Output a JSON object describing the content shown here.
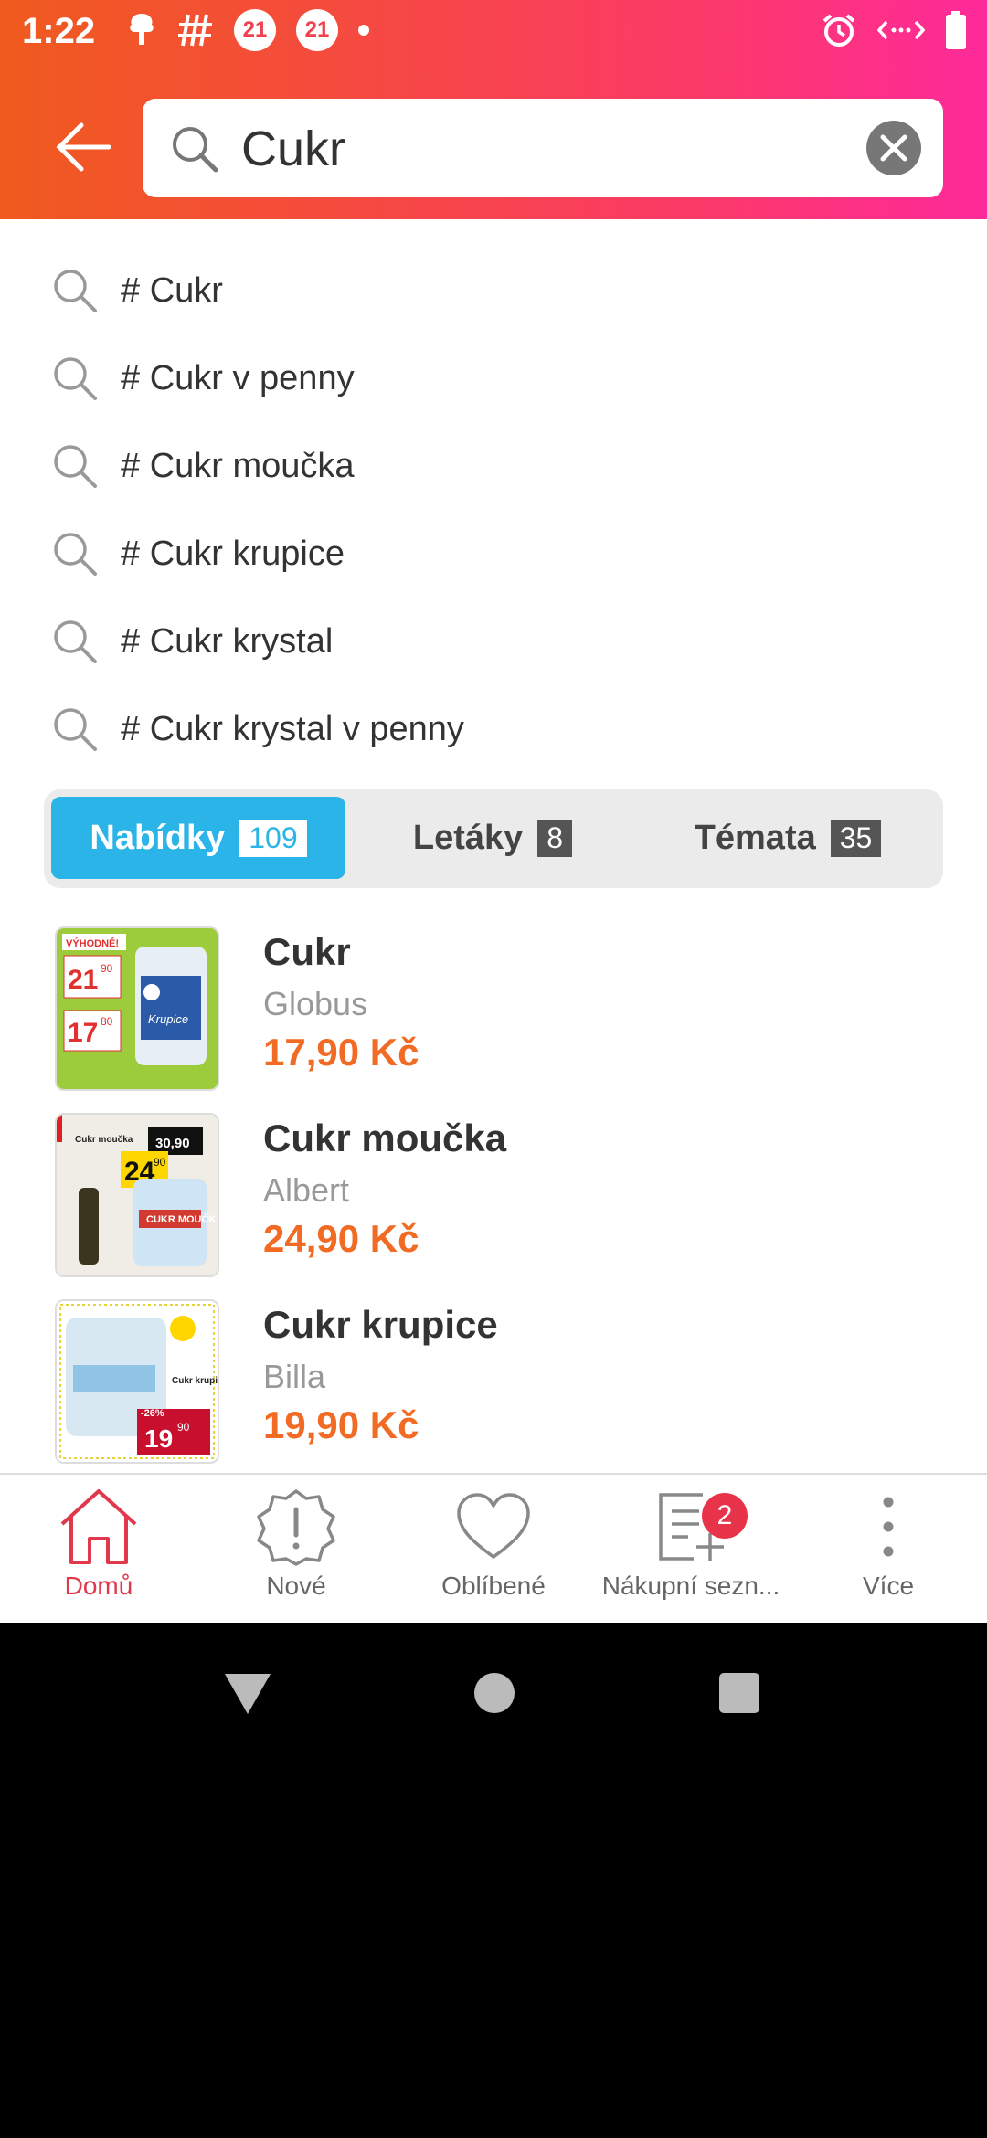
{
  "status_bar": {
    "time": "1:22",
    "badge_a": "21",
    "badge_b": "21"
  },
  "search": {
    "query": "Cukr"
  },
  "suggestions": [
    "# Cukr",
    "# Cukr v penny",
    "# Cukr moučka",
    "# Cukr krupice",
    "# Cukr krystal",
    "# Cukr krystal v penny"
  ],
  "tabs": [
    {
      "label": "Nabídky",
      "count": "109",
      "active": true
    },
    {
      "label": "Letáky",
      "count": "8",
      "active": false
    },
    {
      "label": "Témata",
      "count": "35",
      "active": false
    }
  ],
  "products": [
    {
      "name": "Cukr",
      "store": "Globus",
      "price": "17,90 Kč"
    },
    {
      "name": "Cukr moučka",
      "store": "Albert",
      "price": "24,90 Kč"
    },
    {
      "name": "Cukr krupice",
      "store": "Billa",
      "price": "19,90 Kč"
    }
  ],
  "thumbs": {
    "globus": {
      "tag": "VÝHODNĚ!",
      "old_price": "21",
      "old_cents": "90",
      "new_price": "17",
      "new_cents": "80",
      "item": "Krupice"
    },
    "albert": {
      "brand": "Cukr moučka",
      "price_a": "30,90",
      "price_b": "24",
      "price_b_cents": "90",
      "pack": "CUKR MOUČKA"
    },
    "billa": {
      "discount": "-26%",
      "price": "19",
      "cents": "90",
      "label": "Cukr krupice"
    }
  },
  "bottom_nav": [
    {
      "label": "Domů",
      "active": true
    },
    {
      "label": "Nové",
      "active": false
    },
    {
      "label": "Oblíbené",
      "active": false
    },
    {
      "label": "Nákupní sezn...",
      "active": false,
      "badge": "2"
    },
    {
      "label": "Více",
      "active": false
    }
  ],
  "colors": {
    "accent_orange": "#f26b24",
    "tab_blue": "#2ab4e8",
    "active_red": "#e0384c"
  }
}
